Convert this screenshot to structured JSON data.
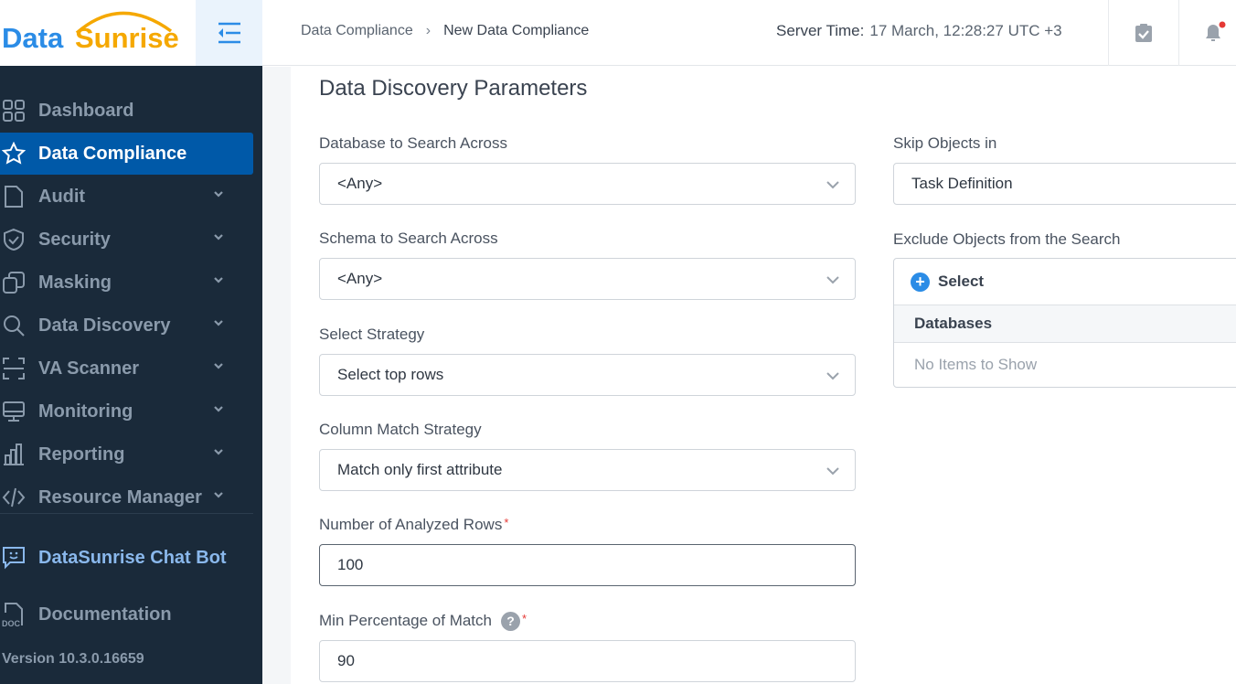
{
  "logo": {
    "part1": "Data",
    "part2": "Sunrise",
    "color1": "#2b8ce6",
    "color2": "#f5a800"
  },
  "header": {
    "breadcrumb": [
      "Data Compliance",
      "New Data Compliance"
    ],
    "breadcrumb_sep": "›",
    "server_time_label": "Server Time:",
    "server_time_value": "17 March, 12:28:27  UTC +3",
    "notification_dot": true
  },
  "sidebar": {
    "items": [
      {
        "label": "Dashboard",
        "icon": "grid-icon",
        "expandable": false,
        "active": false
      },
      {
        "label": "Data Compliance",
        "icon": "star-icon",
        "expandable": false,
        "active": true
      },
      {
        "label": "Audit",
        "icon": "file-icon",
        "expandable": true
      },
      {
        "label": "Security",
        "icon": "shield-icon",
        "expandable": true
      },
      {
        "label": "Masking",
        "icon": "masking-icon",
        "expandable": true
      },
      {
        "label": "Data Discovery",
        "icon": "search-icon",
        "expandable": true
      },
      {
        "label": "VA Scanner",
        "icon": "scanner-icon",
        "expandable": true
      },
      {
        "label": "Monitoring",
        "icon": "monitor-icon",
        "expandable": true
      },
      {
        "label": "Reporting",
        "icon": "bar-chart-icon",
        "expandable": true
      },
      {
        "label": "Resource Manager",
        "icon": "code-icon",
        "expandable": true
      }
    ],
    "chatbot": "DataSunrise Chat Bot",
    "documentation": "Documentation",
    "version": "Version 10.3.0.16659"
  },
  "main": {
    "title": "Data Discovery Parameters",
    "left": [
      {
        "label": "Database to Search Across",
        "value": "<Any>",
        "type": "select"
      },
      {
        "label": "Schema to Search Across",
        "value": "<Any>",
        "type": "select"
      },
      {
        "label": "Select Strategy",
        "value": "Select top rows",
        "type": "select"
      },
      {
        "label": "Column Match Strategy",
        "value": "Match only first attribute",
        "type": "select"
      },
      {
        "label": "Number of Analyzed Rows",
        "value": "100",
        "type": "input",
        "required": "*"
      },
      {
        "label": "Min Percentage of Match",
        "value": "90",
        "type": "input",
        "required": "*",
        "help": "?"
      }
    ],
    "skip": {
      "label": "Skip Objects in",
      "value": "Task Definition"
    },
    "exclude": {
      "label": "Exclude Objects from the Search",
      "select": "Select",
      "column": "Databases",
      "empty": "No Items to Show"
    }
  }
}
